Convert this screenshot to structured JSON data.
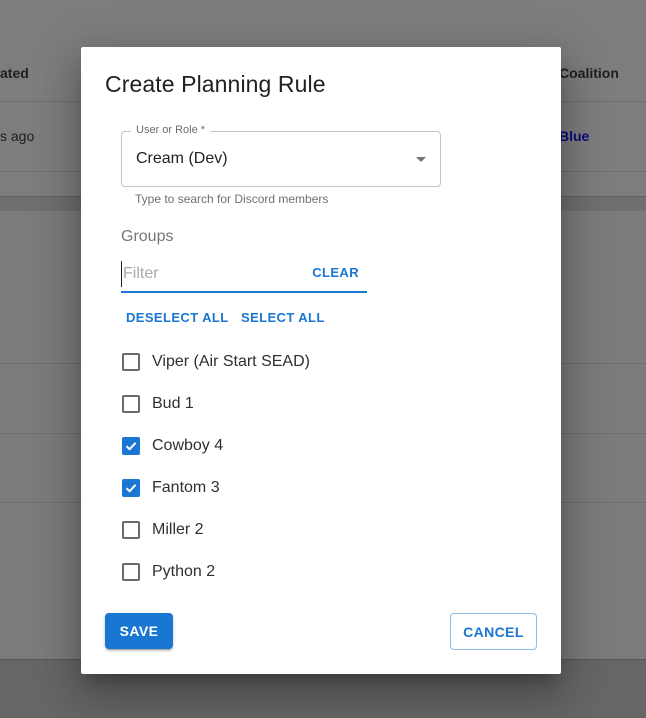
{
  "background": {
    "table_headers": [
      "ated",
      "Coalition"
    ],
    "row_cells": [
      "s ago",
      "Blue"
    ]
  },
  "dialog": {
    "title": "Create Planning Rule",
    "user_or_role": {
      "label": "User or Role *",
      "value": "Cream (Dev)",
      "helper_text": "Type to search for Discord members"
    },
    "groups": {
      "label": "Groups",
      "filter": {
        "value": "",
        "placeholder": "Filter"
      },
      "clear_label": "CLEAR",
      "deselect_all_label": "DESELECT ALL",
      "select_all_label": "SELECT ALL",
      "items": [
        {
          "label": "Viper (Air Start SEAD)",
          "checked": false
        },
        {
          "label": "Bud 1",
          "checked": false
        },
        {
          "label": "Cowboy 4",
          "checked": true
        },
        {
          "label": "Fantom 3",
          "checked": true
        },
        {
          "label": "Miller 2",
          "checked": false
        },
        {
          "label": "Python 2",
          "checked": false
        }
      ]
    },
    "actions": {
      "save_label": "SAVE",
      "cancel_label": "CANCEL"
    }
  },
  "colors": {
    "primary": "#1976d2",
    "overlay": "#7b7b7b",
    "coalition_blue": "#0a0a7a"
  }
}
